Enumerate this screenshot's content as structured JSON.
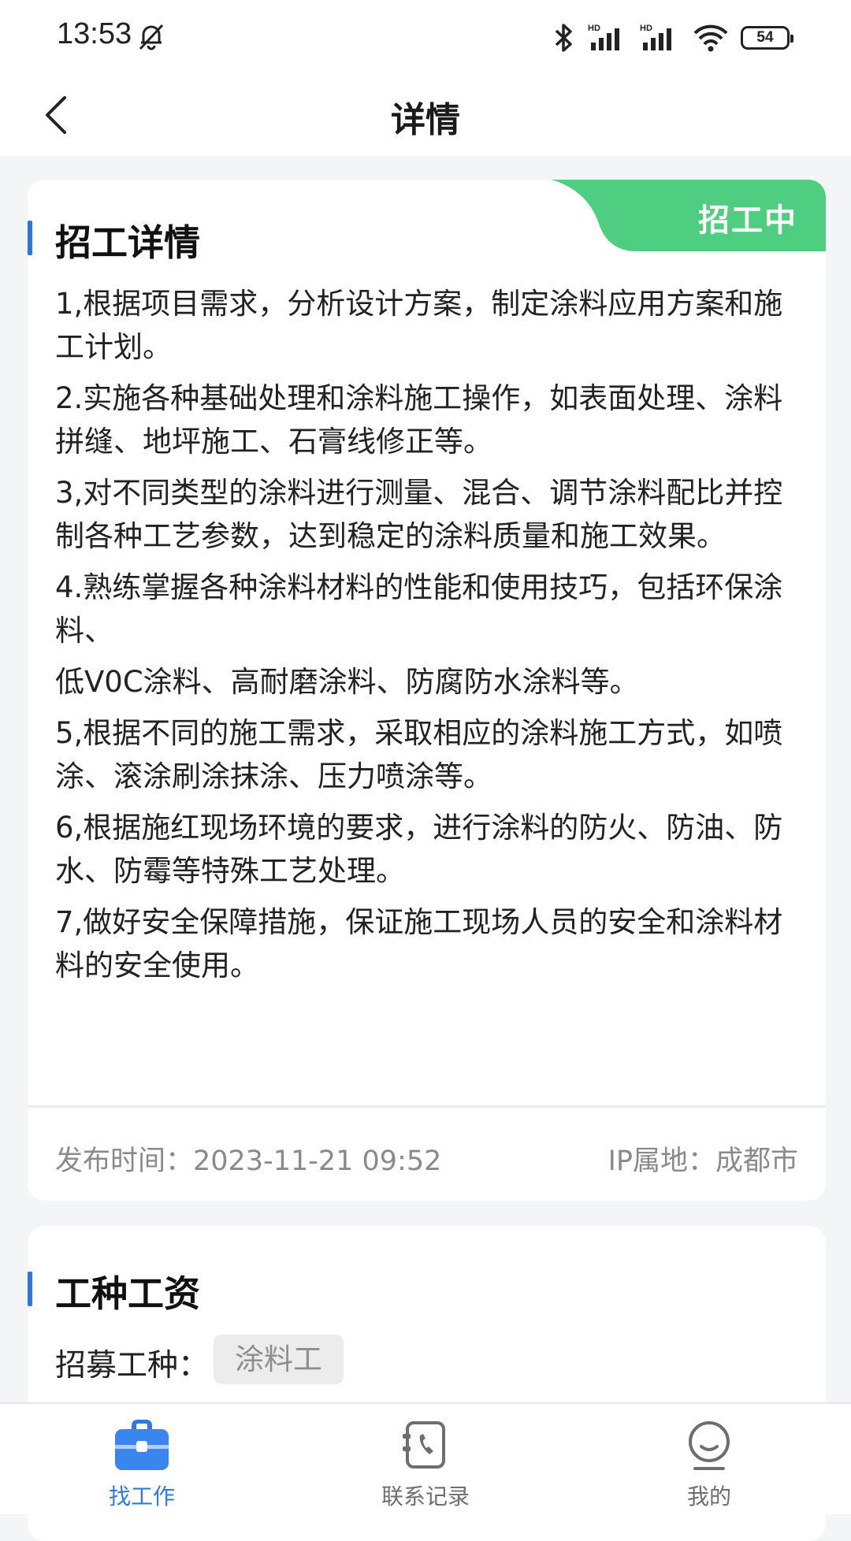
{
  "status_bar": {
    "time": "13:53",
    "battery": "54"
  },
  "nav": {
    "title": "详情"
  },
  "detail": {
    "status_badge": "招工中",
    "section_title": "招工详情",
    "paragraphs": [
      "1,根据项目需求，分析设计方案，制定涂料应用方案和施工计划。",
      "2.实施各种基础处理和涂料施工操作，如表面处理、涂料拼缝、地坪施工、石膏线修正等。",
      "3,对不同类型的涂料进行测量、混合、调节涂料配比并控制各种工艺参数，达到稳定的涂料质量和施工效果。",
      "4.熟练掌握各种涂料材料的性能和使用技巧，包括环保涂料、",
      "低V0C涂料、高耐磨涂料、防腐防水涂料等。",
      "5,根据不同的施工需求，采取相应的涂料施工方式，如喷涂、滚涂刷涂抹涂、压力喷涂等。",
      "6,根据施红现场环境的要求，进行涂料的防火、防油、防水、防霉等特殊工艺处理。",
      "7,做好安全保障措施，保证施工现场人员的安全和涂料材料的安全使用。"
    ],
    "publish_time": "发布时间：2023-11-21 09:52",
    "ip_location": "IP属地：成都市"
  },
  "wage": {
    "section_title": "工种工资",
    "trade_label": "招募工种：",
    "trade_value": "涂料工"
  },
  "tabs": [
    {
      "label": "找工作",
      "icon": "briefcase-icon",
      "active": true
    },
    {
      "label": "联系记录",
      "icon": "phone-record-icon",
      "active": false
    },
    {
      "label": "我的",
      "icon": "profile-icon",
      "active": false
    }
  ],
  "colors": {
    "accent": "#2c7be5",
    "badge_green": "#4fce82",
    "section_bar": "#2b74e6"
  }
}
